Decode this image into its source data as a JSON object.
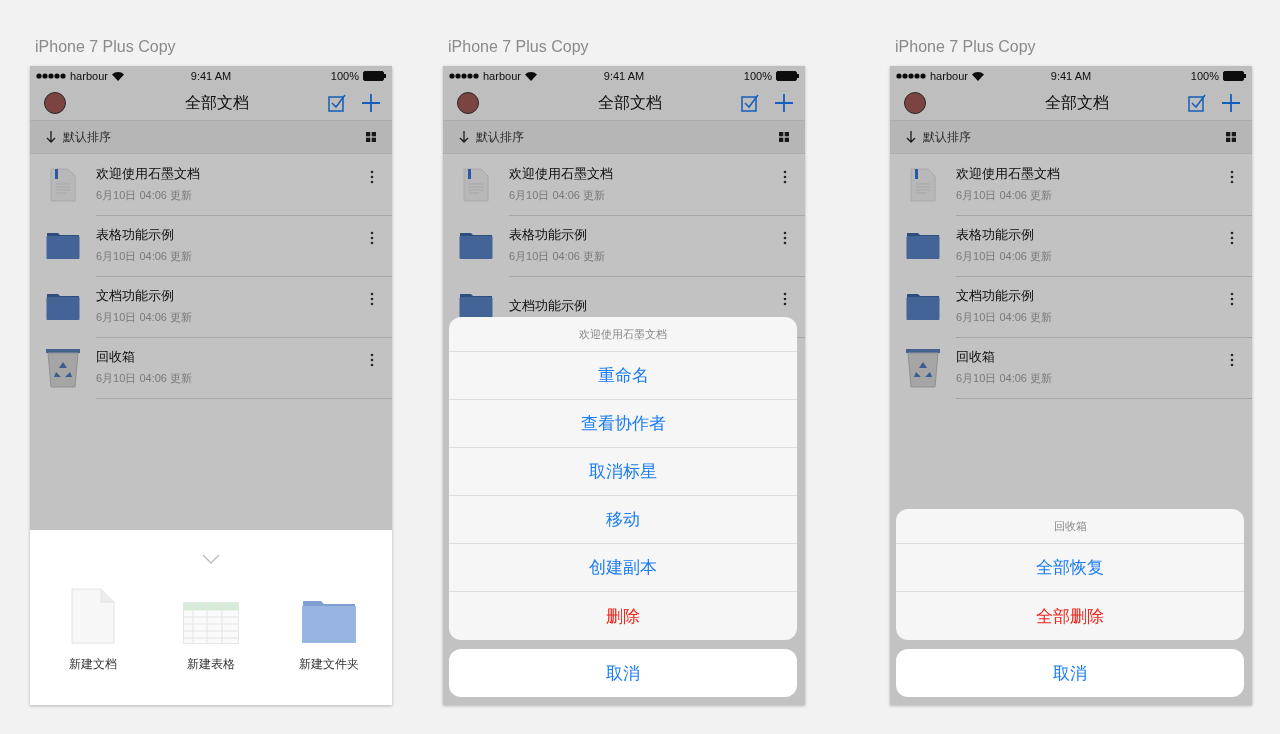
{
  "artboards": [
    {
      "label": "iPhone 7 Plus Copy",
      "status": {
        "carrier": "harbour",
        "time": "9:41 AM",
        "battery": "100%"
      },
      "nav": {
        "title": "全部文档"
      },
      "sort": {
        "label": "默认排序"
      },
      "files": [
        {
          "kind": "doc",
          "name": "欢迎使用石墨文档",
          "meta": "6月10日 04:06 更新"
        },
        {
          "kind": "folder",
          "name": "表格功能示例",
          "meta": "6月10日 04:06 更新"
        },
        {
          "kind": "folder",
          "name": "文档功能示例",
          "meta": "6月10日 04:06 更新"
        },
        {
          "kind": "trash",
          "name": "回收箱",
          "meta": "6月10日 04:06 更新"
        }
      ],
      "overlay": {
        "kind": "create",
        "items": [
          {
            "kind": "doc",
            "label": "新建文档"
          },
          {
            "kind": "sheet",
            "label": "新建表格"
          },
          {
            "kind": "folder",
            "label": "新建文件夹"
          }
        ]
      }
    },
    {
      "label": "iPhone 7 Plus Copy",
      "status": {
        "carrier": "harbour",
        "time": "9:41 AM",
        "battery": "100%"
      },
      "nav": {
        "title": "全部文档"
      },
      "sort": {
        "label": "默认排序"
      },
      "files": [
        {
          "kind": "doc",
          "name": "欢迎使用石墨文档",
          "meta": "6月10日 04:06 更新"
        },
        {
          "kind": "folder",
          "name": "表格功能示例",
          "meta": "6月10日 04:06 更新"
        },
        {
          "kind": "folder",
          "name": "文档功能示例"
        }
      ],
      "overlay": {
        "kind": "action_sheet",
        "title": "欢迎使用石墨文档",
        "actions": [
          {
            "label": "重命名",
            "destructive": false
          },
          {
            "label": "查看协作者",
            "destructive": false
          },
          {
            "label": "取消标星",
            "destructive": false
          },
          {
            "label": "移动",
            "destructive": false
          },
          {
            "label": "创建副本",
            "destructive": false
          },
          {
            "label": "删除",
            "destructive": true
          }
        ],
        "cancel": "取消"
      }
    },
    {
      "label": "iPhone 7 Plus Copy",
      "status": {
        "carrier": "harbour",
        "time": "9:41 AM",
        "battery": "100%"
      },
      "nav": {
        "title": "全部文档"
      },
      "sort": {
        "label": "默认排序"
      },
      "files": [
        {
          "kind": "doc",
          "name": "欢迎使用石墨文档",
          "meta": "6月10日 04:06 更新"
        },
        {
          "kind": "folder",
          "name": "表格功能示例",
          "meta": "6月10日 04:06 更新"
        },
        {
          "kind": "folder",
          "name": "文档功能示例",
          "meta": "6月10日 04:06 更新"
        },
        {
          "kind": "trash",
          "name": "回收箱",
          "meta": "6月10日 04:06 更新"
        }
      ],
      "overlay": {
        "kind": "action_sheet",
        "title": "回收箱",
        "actions": [
          {
            "label": "全部恢复",
            "destructive": false
          },
          {
            "label": "全部删除",
            "destructive": true
          }
        ],
        "cancel": "取消"
      }
    }
  ]
}
